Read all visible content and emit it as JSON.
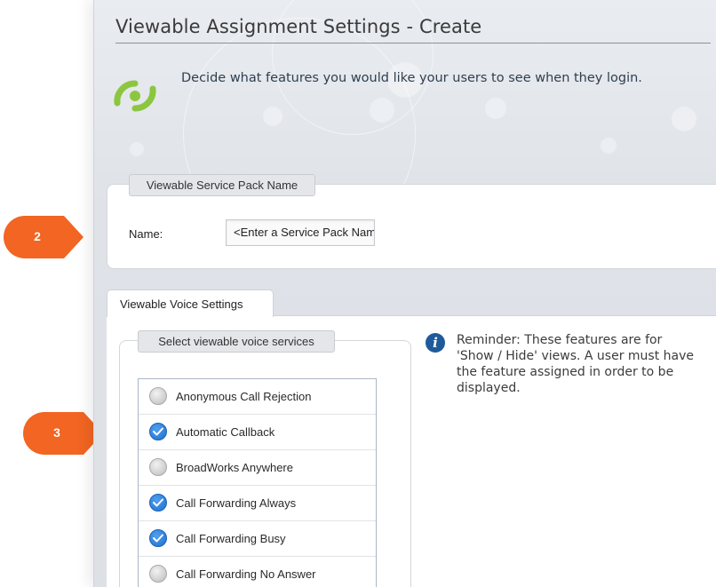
{
  "page": {
    "title": "Viewable Assignment Settings - Create",
    "intro": "Decide what features you would like your users to see when they login.",
    "logo_icon": "broadcast-logo-icon",
    "accent_green": "#8cc63f"
  },
  "service_pack": {
    "legend": "Viewable Service Pack Name",
    "name_label": "Name:",
    "name_placeholder": "<Enter a Service Pack Name>"
  },
  "voice": {
    "tab_label": "Viewable Voice Settings",
    "legend": "Select viewable voice services",
    "services": [
      {
        "label": "Anonymous Call Rejection",
        "selected": false
      },
      {
        "label": "Automatic Callback",
        "selected": true
      },
      {
        "label": "BroadWorks Anywhere",
        "selected": false
      },
      {
        "label": "Call Forwarding Always",
        "selected": true
      },
      {
        "label": "Call Forwarding Busy",
        "selected": true
      },
      {
        "label": "Call Forwarding No Answer",
        "selected": false
      }
    ],
    "info_icon": "info-icon",
    "reminder": "Reminder: These features are for 'Show / Hide' views. A user must have the feature assigned in order to be displayed."
  },
  "callouts": [
    {
      "number": "2",
      "color": "#f26522"
    },
    {
      "number": "3",
      "color": "#f26522"
    }
  ]
}
